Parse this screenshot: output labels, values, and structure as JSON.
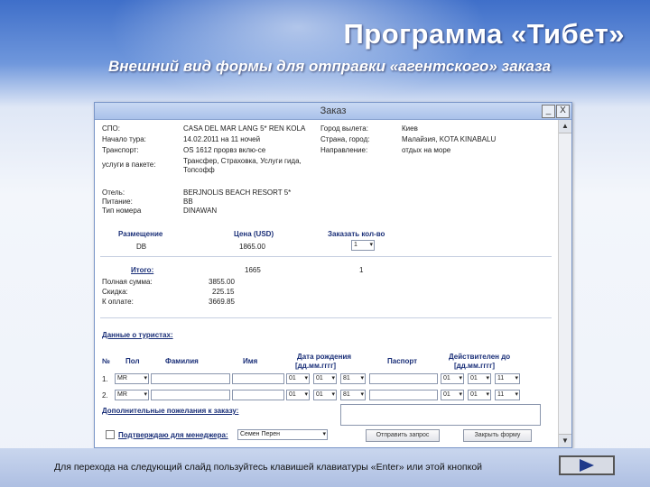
{
  "slide": {
    "title": "Программа «Тибет»",
    "subtitle": "Внешний вид формы для отправки «агентского» заказа"
  },
  "window": {
    "title": "Заказ",
    "minimize": "_",
    "close": "X"
  },
  "info_left": [
    {
      "label": "СПО:",
      "value": "CASA DEL MAR LANG 5* REN KOLA"
    },
    {
      "label": "Начало тура:",
      "value": "14.02.2011 на 11 ночей"
    },
    {
      "label": "Транспорт:",
      "value": "OS 1612 прорвз вклю-се"
    },
    {
      "label": "услуги в пакете:",
      "value": "Трансфер, Страховка, Услуги гида,"
    },
    {
      "label": "",
      "value": "Топсофф"
    }
  ],
  "info_right": [
    {
      "label": "Город вылета:",
      "value": "Киев"
    },
    {
      "label": "Страна, город:",
      "value": "Малайзия, KOTA KINABALU"
    },
    {
      "label": "Направление:",
      "value": "отдых на море"
    }
  ],
  "hotel": [
    {
      "label": "Отель:",
      "value": "BERJNOLIS BEACH RESORT 5*"
    },
    {
      "label": "Питание:",
      "value": "BB"
    },
    {
      "label": "Тип номера",
      "value": "DINAWAN"
    }
  ],
  "order_table": {
    "headers": [
      "Размещение",
      "Цена (USD)",
      "Заказать кол-во"
    ],
    "row": {
      "placement": "DB",
      "price": "1865.00",
      "qty": "1"
    }
  },
  "totals": {
    "label": "Итого:",
    "price": "1665",
    "qty": "1",
    "lines": [
      {
        "label": "Полная сумма:",
        "value": "3855.00"
      },
      {
        "label": "Скидка:",
        "value": "225.15"
      },
      {
        "label": "К оплате:",
        "value": "3669.85"
      }
    ]
  },
  "tourists": {
    "section_title": "Данные о туристах:",
    "headers": {
      "num": "№",
      "gender": "Пол",
      "surname": "Фамилия",
      "name": "Имя",
      "dob": "Дата рождения",
      "dob_fmt": "[дд.мм.гггг]",
      "passport": "Паспорт",
      "valid": "Действителен до",
      "valid_fmt": "[дд.мм.гггг]"
    },
    "rows": [
      {
        "num": "1.",
        "gender": "MR",
        "dob_d": "01",
        "dob_m": "01",
        "dob_y": "81",
        "valid_d": "01",
        "valid_m": "01",
        "valid_y": "11"
      },
      {
        "num": "2.",
        "gender": "MR",
        "dob_d": "01",
        "dob_m": "01",
        "dob_y": "81",
        "valid_d": "01",
        "valid_m": "01",
        "valid_y": "11"
      }
    ]
  },
  "wishes_label": "Дополнительные пожелания к заказу:",
  "footer": {
    "confirm_label": "Подтверждаю для менеджера:",
    "manager": "Семен Перен",
    "send_button": "Отправить запрос",
    "close_button": "Закрыть форму"
  },
  "bottom_note": "Для перехода на следующий слайд пользуйтесь клавишей клавиатуры «Enter» или этой кнопкой",
  "colors": {
    "accent": "#1a2f78",
    "title_blue": "#3f6fc9"
  }
}
